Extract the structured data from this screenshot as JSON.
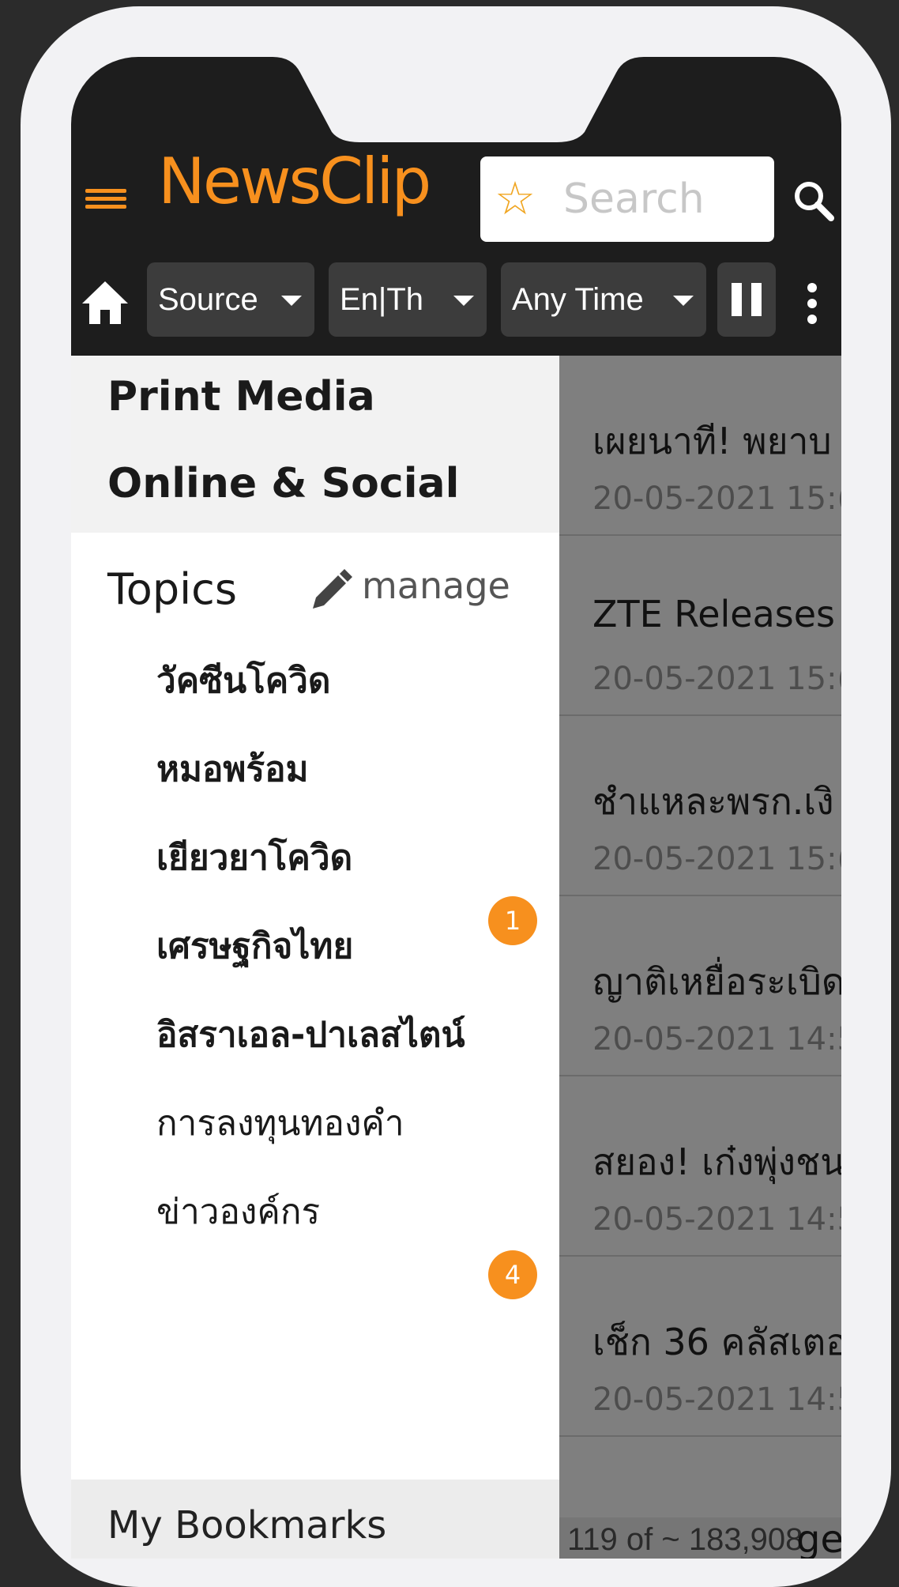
{
  "app": {
    "logo": "NewsClip"
  },
  "search": {
    "placeholder": "Search",
    "star_icon": "star-icon",
    "search_icon": "search-icon"
  },
  "filters": {
    "source": "Source",
    "language": "En|Th",
    "time": "Any Time"
  },
  "drawer": {
    "sources": [
      "Print Media",
      "Online & Social"
    ],
    "topics_label": "Topics",
    "manage_label": "manage",
    "topics": [
      {
        "label": "วัคซีนโควิด",
        "bold": true,
        "badge": ""
      },
      {
        "label": "หมอพร้อม",
        "bold": true,
        "badge": ""
      },
      {
        "label": "เยียวยาโควิด",
        "bold": true,
        "badge": "1"
      },
      {
        "label": "เศรษฐกิจไทย",
        "bold": true,
        "badge": ""
      },
      {
        "label": "อิสราเอล-ปาเลสไตน์",
        "bold": true,
        "badge": ""
      },
      {
        "label": "การลงทุนทองคำ",
        "bold": false,
        "badge": ""
      },
      {
        "label": "ข่าวองค์กร",
        "bold": false,
        "badge": "4"
      }
    ],
    "bookmarks_label": "My Bookmarks"
  },
  "news": {
    "items": [
      {
        "title": "เผยนาที! พยาบ",
        "date": "20-05-2021  15:("
      },
      {
        "title": "ZTE Releases",
        "date": "20-05-2021  15:("
      },
      {
        "title": "ชำแหละพรก.เงิ",
        "date": "20-05-2021  15:("
      },
      {
        "title": "ญาติเหยื่อระเบิด",
        "date": "20-05-2021  14:5"
      },
      {
        "title": "สยอง! เก๋งพุ่งชน",
        "date": "20-05-2021  14:5"
      },
      {
        "title": "เช็ก 36 คลัสเตอ",
        "date": "20-05-2021  14:5"
      }
    ],
    "pager": "119 of ~ 183,908",
    "pager_tail": "ge"
  },
  "colors": {
    "accent": "#f7901e",
    "header_bg": "#1d1d1d",
    "pill_bg": "#3c3c3c"
  }
}
